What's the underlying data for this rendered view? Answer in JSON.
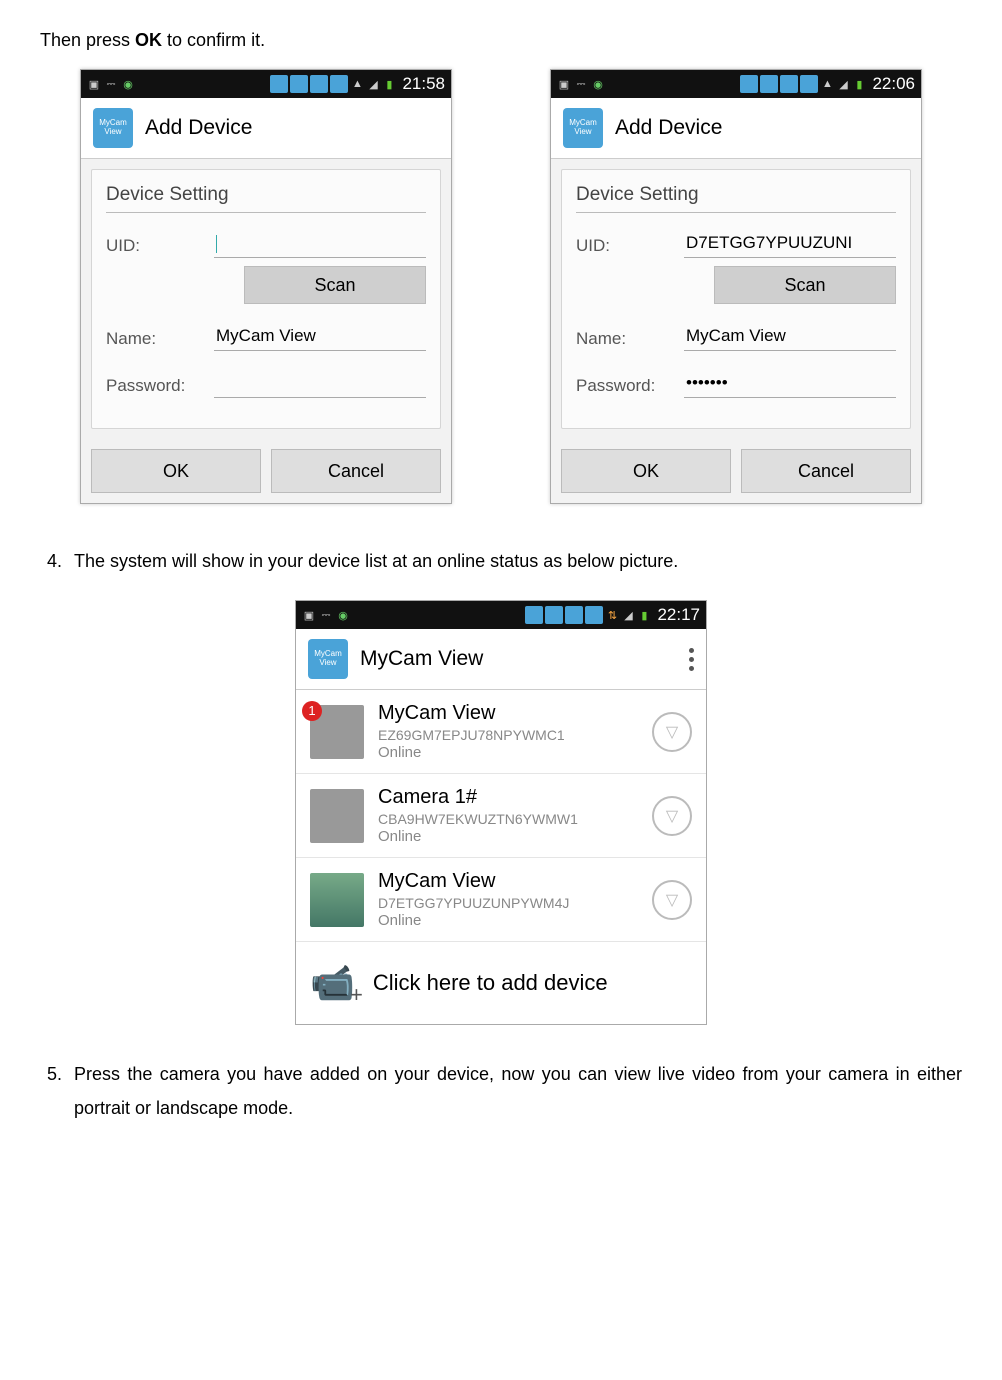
{
  "intro_prefix": "Then press ",
  "intro_bold": "OK",
  "intro_suffix": " to confirm it.",
  "statusbar": {
    "time_left": "21:58",
    "time_right": "22:06",
    "time_list": "22:17"
  },
  "title": "Add Device",
  "panel_title": "Device Setting",
  "labels": {
    "uid": "UID:",
    "name": "Name:",
    "password": "Password:"
  },
  "left": {
    "uid": "",
    "name": "MyCam View",
    "password": ""
  },
  "right": {
    "uid": "D7ETGG7YPUUZUNI",
    "name": "MyCam View",
    "password": "•••••••"
  },
  "buttons": {
    "scan": "Scan",
    "ok": "OK",
    "cancel": "Cancel"
  },
  "step4_num": "4.",
  "step4_text": "The system will show in your device list at an online status as below picture.",
  "list": {
    "title": "MyCam View",
    "items": [
      {
        "badge": "1",
        "name": "MyCam View",
        "uid": "EZ69GM7EPJU78NPYWMC1",
        "status": "Online"
      },
      {
        "badge": "",
        "name": "Camera 1#",
        "uid": "CBA9HW7EKWUZTN6YWMW1",
        "status": "Online"
      },
      {
        "badge": "",
        "name": "MyCam View",
        "uid": "D7ETGG7YPUUZUNPYWM4J",
        "status": "Online"
      }
    ],
    "add_text": "Click here to add device"
  },
  "step5_num": "5.",
  "step5_text": "Press the camera you have added on your device, now you can view live video from your camera in either portrait or landscape mode."
}
